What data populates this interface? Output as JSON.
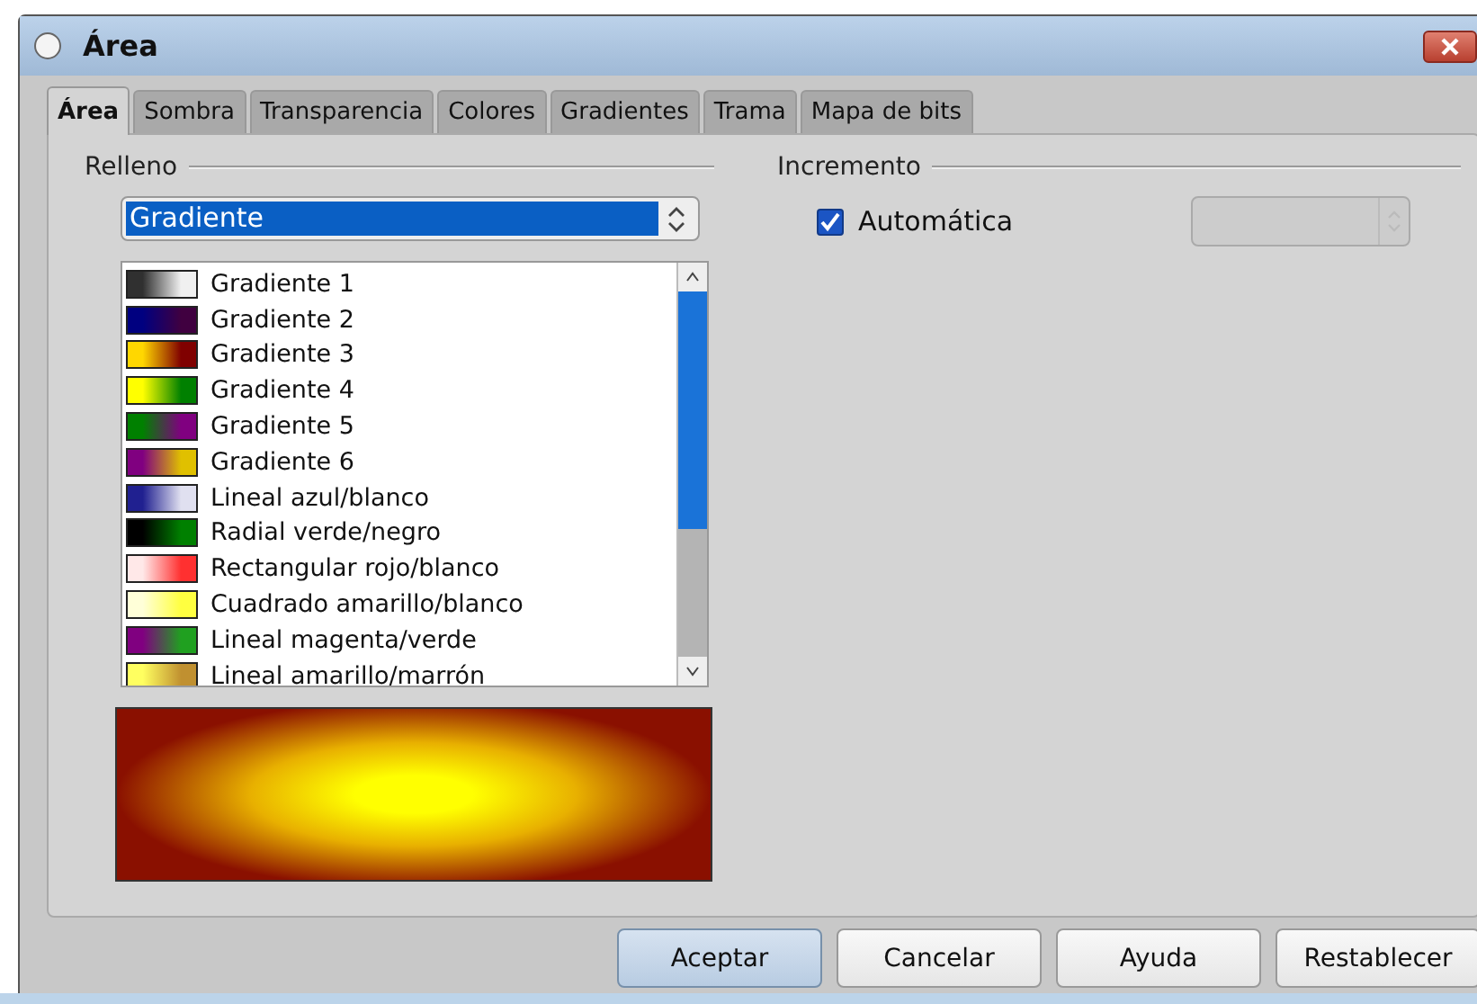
{
  "window": {
    "title": "Área"
  },
  "tabs": [
    {
      "label": "Área",
      "selected": true
    },
    {
      "label": "Sombra",
      "selected": false
    },
    {
      "label": "Transparencia",
      "selected": false
    },
    {
      "label": "Colores",
      "selected": false
    },
    {
      "label": "Gradientes",
      "selected": false
    },
    {
      "label": "Trama",
      "selected": false
    },
    {
      "label": "Mapa de bits",
      "selected": false
    }
  ],
  "fill": {
    "heading": "Relleno",
    "type_select": {
      "value": "Gradiente"
    },
    "gradients": [
      {
        "name": "Gradiente 1",
        "stops": [
          {
            "color": "#303030"
          },
          {
            "color": "#f0f0f0"
          }
        ]
      },
      {
        "name": "Gradiente 2",
        "stops": [
          {
            "color": "#000080"
          },
          {
            "color": "#400040"
          }
        ]
      },
      {
        "name": "Gradiente 3",
        "stops": [
          {
            "color": "#ffd700"
          },
          {
            "color": "#800000"
          }
        ]
      },
      {
        "name": "Gradiente 4",
        "stops": [
          {
            "color": "#ffff00"
          },
          {
            "color": "#008000"
          }
        ]
      },
      {
        "name": "Gradiente 5",
        "stops": [
          {
            "color": "#008000"
          },
          {
            "color": "#800080"
          }
        ]
      },
      {
        "name": "Gradiente 6",
        "stops": [
          {
            "color": "#800080"
          },
          {
            "color": "#e0c000"
          }
        ]
      },
      {
        "name": "Lineal azul/blanco",
        "stops": [
          {
            "color": "#202090"
          },
          {
            "color": "#e0e0f0"
          }
        ]
      },
      {
        "name": "Radial verde/negro",
        "stops": [
          {
            "color": "#000000"
          },
          {
            "color": "#008000"
          }
        ]
      },
      {
        "name": "Rectangular rojo/blanco",
        "stops": [
          {
            "color": "#ffe8e8"
          },
          {
            "color": "#ff3030"
          }
        ]
      },
      {
        "name": "Cuadrado amarillo/blanco",
        "stops": [
          {
            "color": "#ffffd8"
          },
          {
            "color": "#ffff40"
          }
        ]
      },
      {
        "name": "Lineal magenta/verde",
        "stops": [
          {
            "color": "#800080"
          },
          {
            "color": "#20a020"
          }
        ]
      },
      {
        "name": "Lineal amarillo/marrón",
        "stops": [
          {
            "color": "#ffff60"
          },
          {
            "color": "#c09030"
          }
        ]
      }
    ]
  },
  "increment": {
    "heading": "Incremento",
    "automatic": {
      "label": "Automática",
      "checked": true
    }
  },
  "buttons": [
    {
      "label": "Aceptar",
      "default": true
    },
    {
      "label": "Cancelar",
      "default": false
    },
    {
      "label": "Ayuda",
      "default": false
    },
    {
      "label": "Restablecer",
      "default": false
    }
  ]
}
